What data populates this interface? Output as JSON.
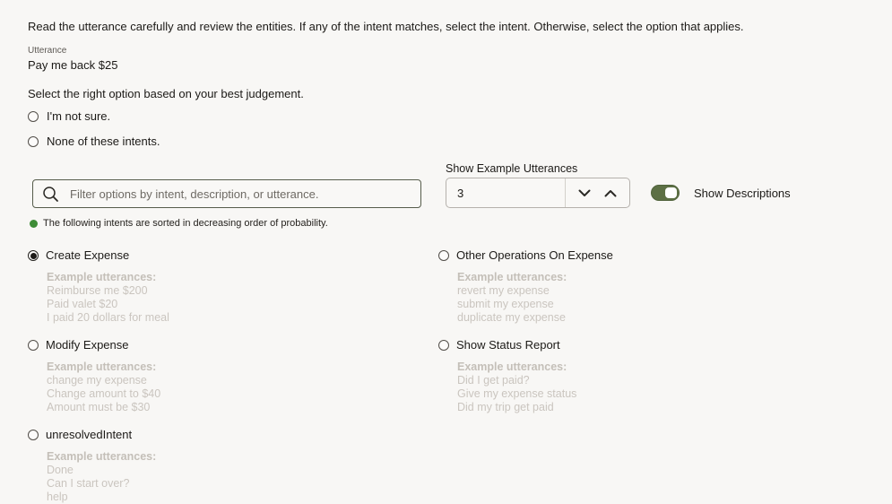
{
  "page": {
    "instruction": "Read the utterance carefully and review the entities. If any of the intent matches, select the intent. Otherwise, select the option that applies.",
    "utterance_label": "Utterance",
    "utterance_value": "Pay me back $25",
    "prompt": "Select the right option based on your best judgement."
  },
  "fallback_options": [
    {
      "label": "I'm not sure.",
      "selected": false
    },
    {
      "label": "None of these intents.",
      "selected": false
    }
  ],
  "filter": {
    "placeholder": "Filter options by intent, description, or utterance."
  },
  "example_count": {
    "label": "Show Example Utterances",
    "value": "3"
  },
  "descriptions_toggle": {
    "label": "Show Descriptions",
    "state": "on",
    "accent_color": "#5d7045"
  },
  "note": {
    "text": "The following intents are sorted in decreasing order of probability.",
    "dot_color": "#3e8c36"
  },
  "options": {
    "examples_heading": "Example utterances:",
    "items": [
      {
        "label": "Create Expense",
        "selected": true,
        "examples": [
          "Reimburse me $200",
          "Paid valet $20",
          "I paid 20 dollars for meal"
        ]
      },
      {
        "label": "Other Operations On Expense",
        "selected": false,
        "examples": [
          "revert my expense",
          "submit my expense",
          "duplicate my expense"
        ]
      },
      {
        "label": "Modify Expense",
        "selected": false,
        "examples": [
          "change my expense",
          "Change amount to $40",
          "Amount must be $30"
        ]
      },
      {
        "label": "Show Status Report",
        "selected": false,
        "examples": [
          "Did I get paid?",
          "Give my expense status",
          "Did my trip get paid"
        ]
      },
      {
        "label": "unresolvedIntent",
        "selected": false,
        "examples": [
          "Done",
          "Can I start over?",
          "help"
        ]
      }
    ]
  }
}
